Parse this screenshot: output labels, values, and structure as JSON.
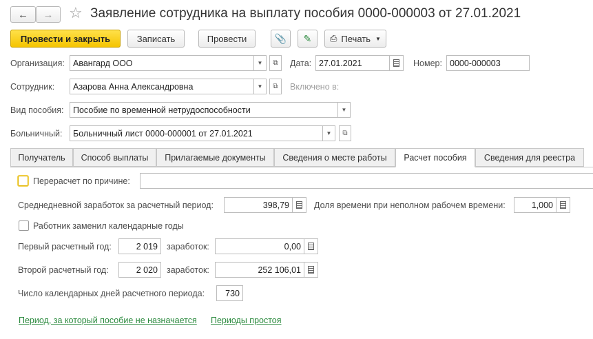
{
  "title": "Заявление сотрудника на выплату пособия 0000-000003 от 27.01.2021",
  "toolbar": {
    "post_close": "Провести и закрыть",
    "save": "Записать",
    "post": "Провести",
    "print": "Печать"
  },
  "header": {
    "org_label": "Организация:",
    "org_value": "Авангард ООО",
    "date_label": "Дата:",
    "date_value": "27.01.2021",
    "number_label": "Номер:",
    "number_value": "0000-000003",
    "employee_label": "Сотрудник:",
    "employee_value": "Азарова Анна Александровна",
    "included_label": "Включено в:",
    "benefit_label": "Вид пособия:",
    "benefit_value": "Пособие по временной нетрудоспособности",
    "sick_label": "Больничный:",
    "sick_value": "Больничный лист 0000-000001 от 27.01.2021"
  },
  "tabs": [
    {
      "label": "Получатель"
    },
    {
      "label": "Способ выплаты"
    },
    {
      "label": "Прилагаемые документы"
    },
    {
      "label": "Сведения о месте работы"
    },
    {
      "label": "Расчет пособия"
    },
    {
      "label": "Сведения для реестра"
    }
  ],
  "calc": {
    "recalc_label": "Перерасчет по причине:",
    "recalc_value": "",
    "avg_label": "Среднедневной заработок за расчетный период:",
    "avg_value": "398,79",
    "share_label": "Доля времени при неполном рабочем времени:",
    "share_value": "1,000",
    "replaced_label": "Работник заменил календарные годы",
    "first_year_label": "Первый расчетный год:",
    "first_year_value": "2 019",
    "first_earn_label": "заработок:",
    "first_earn_value": "0,00",
    "second_year_label": "Второй расчетный год:",
    "second_year_value": "2 020",
    "second_earn_label": "заработок:",
    "second_earn_value": "252 106,01",
    "days_label": "Число календарных дней расчетного периода:",
    "days_value": "730",
    "link_period": "Период, за который пособие не назначается",
    "link_idle": "Периоды простоя"
  }
}
